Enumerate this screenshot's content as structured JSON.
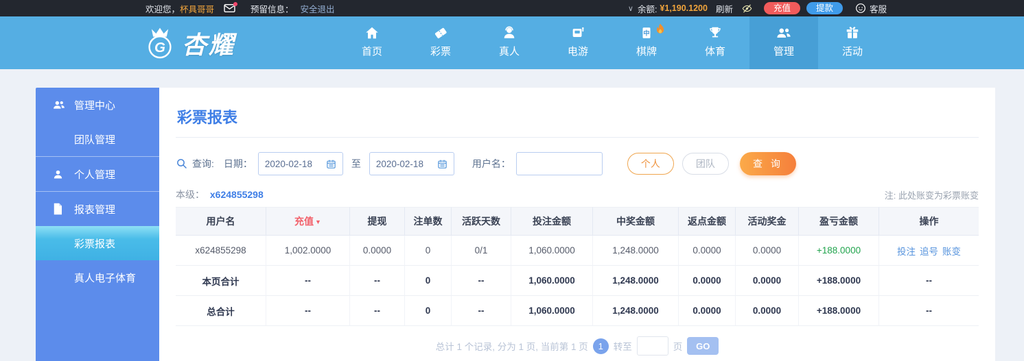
{
  "icons": {
    "chevron_down": "∨",
    "sort_desc": "▼",
    "mahjong_char": "中",
    "brand_badge": "G"
  },
  "colors": {
    "nav_bg": "#55aee3",
    "nav_active": "#479fd6",
    "sidebar_bg": "#5c8ceb",
    "accent_blue": "#3e7ee6",
    "active_cyan": "#45bbe9",
    "orange_btn": "#f58a3c",
    "recharge_red": "#f25b5b",
    "withdraw_blue": "#3f9bea",
    "profit_green": "#21a44d",
    "balance_orange": "#f0a43c"
  },
  "topbar": {
    "welcome_prefix": "欢迎您，",
    "username": "杯具哥哥",
    "reserved_label": "预留信息：",
    "logout_label": "安全退出",
    "balance_label": "余额:",
    "balance_value": "¥1,190.1200",
    "refresh_label": "刷新",
    "recharge_label": "充值",
    "withdraw_label": "提款",
    "service_label": "客服"
  },
  "nav": {
    "brand": "杏耀",
    "items": [
      {
        "label": "首页"
      },
      {
        "label": "彩票"
      },
      {
        "label": "真人"
      },
      {
        "label": "电游"
      },
      {
        "label": "棋牌"
      },
      {
        "label": "体育"
      },
      {
        "label": "管理",
        "active": true
      },
      {
        "label": "活动"
      }
    ]
  },
  "sidebar": {
    "items": [
      {
        "label": "管理中心"
      },
      {
        "label": "团队管理"
      },
      {
        "label": "个人管理"
      },
      {
        "label": "报表管理"
      },
      {
        "label": "彩票报表",
        "active": true
      },
      {
        "label": "真人电子体育"
      }
    ]
  },
  "main": {
    "title": "彩票报表",
    "search": {
      "query_label": "查询:",
      "date_label": "日期：",
      "date_from": "2020-02-18",
      "to_label": "至",
      "date_to": "2020-02-18",
      "username_label": "用户名：",
      "username_value": "",
      "personal_btn": "个人",
      "team_btn": "团队",
      "query_btn": "查 询"
    },
    "level_label": "本级：",
    "level_value": "x624855298",
    "note": "注: 此处账变为彩票账变",
    "table": {
      "headers": [
        "用户名",
        "充值",
        "提现",
        "注单数",
        "活跃天数",
        "投注金额",
        "中奖金额",
        "返点金额",
        "活动奖金",
        "盈亏金额",
        "操作"
      ],
      "rows": [
        {
          "cells": [
            "x624855298",
            "1,002.0000",
            "0.0000",
            "0",
            "0/1",
            "1,060.0000",
            "1,248.0000",
            "0.0000",
            "0.0000",
            "+188.0000"
          ],
          "ops": [
            "投注",
            "追号",
            "账变"
          ]
        },
        {
          "cells": [
            "本页合计",
            "--",
            "--",
            "0",
            "--",
            "1,060.0000",
            "1,248.0000",
            "0.0000",
            "0.0000",
            "+188.0000"
          ],
          "ops_text": "--"
        },
        {
          "cells": [
            "总合计",
            "--",
            "--",
            "0",
            "--",
            "1,060.0000",
            "1,248.0000",
            "0.0000",
            "0.0000",
            "+188.0000"
          ],
          "ops_text": "--"
        }
      ]
    },
    "pagination": {
      "summary": "总计 1 个记录, 分为 1 页, 当前第 1 页",
      "current_page": "1",
      "goto_label": "转至",
      "page_label": "页",
      "go_btn": "GO"
    }
  }
}
